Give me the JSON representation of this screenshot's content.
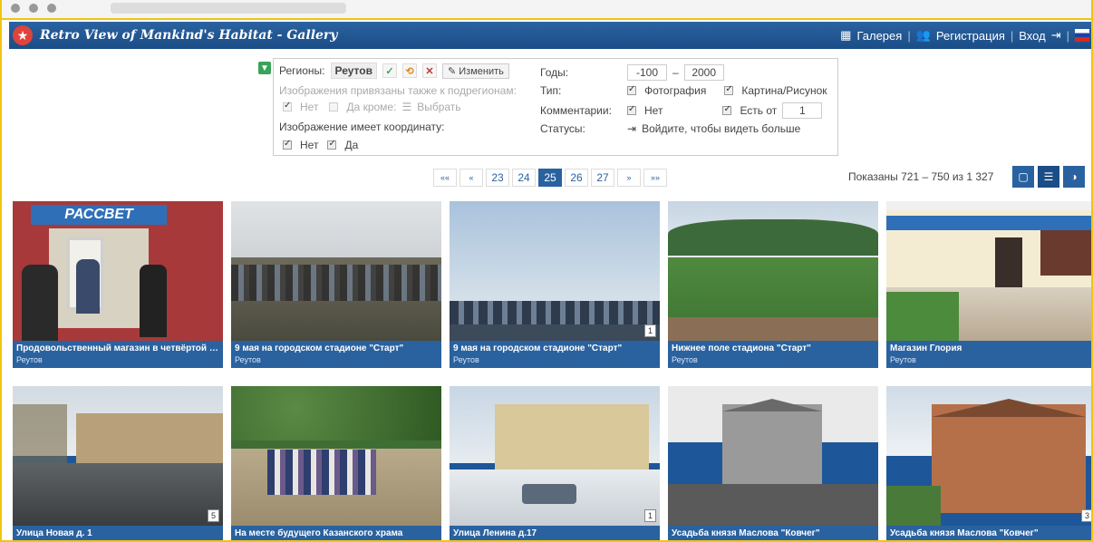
{
  "site": {
    "title": "Retro View of Mankind's Habitat  -  Gallery"
  },
  "nav": {
    "gallery": "Галерея",
    "register": "Регистрация",
    "login": "Вход"
  },
  "filter": {
    "regions_label": "Регионы:",
    "region_value": "Реутов",
    "edit_label": "Изменить",
    "subregions_label": "Изображения привязаны также к подрегионам:",
    "sub_no": "Нет",
    "sub_yes_except": "Да кроме:",
    "sub_choose": "Выбрать",
    "coords_label": "Изображение имеет координату:",
    "coords_no": "Нет",
    "coords_yes": "Да",
    "years_label": "Годы:",
    "year_from": "-100",
    "year_dash": "–",
    "year_to": "2000",
    "type_label": "Тип:",
    "type_photo": "Фотография",
    "type_painting": "Картина/Рисунок",
    "comments_label": "Комментарии:",
    "comments_no": "Нет",
    "comments_from": "Есть от",
    "comments_min": "1",
    "status_label": "Статусы:",
    "status_login": "Войдите, чтобы видеть больше"
  },
  "pager": {
    "first": "««",
    "prev": "«",
    "pages": [
      "23",
      "24",
      "25",
      "26",
      "27"
    ],
    "active": "25",
    "next": "»",
    "last": "»»"
  },
  "shown": "Показаны 721 – 750 из 1 327",
  "photos": [
    {
      "title": "Продовольственный магазин в четвёртой каза...",
      "region": "Реутов",
      "count": ""
    },
    {
      "title": "9 мая на городском стадионе \"Старт\"",
      "region": "Реутов",
      "count": ""
    },
    {
      "title": "9 мая на городском стадионе \"Старт\"",
      "region": "Реутов",
      "count": "1"
    },
    {
      "title": "Нижнее поле стадиона \"Старт\"",
      "region": "Реутов",
      "count": ""
    },
    {
      "title": "Магазин Глория",
      "region": "Реутов",
      "count": ""
    },
    {
      "title": "Улица Новая д. 1",
      "region": "",
      "count": "5"
    },
    {
      "title": "На месте будущего Казанского храма",
      "region": "",
      "count": ""
    },
    {
      "title": "Улица Ленина д.17",
      "region": "",
      "count": "1"
    },
    {
      "title": "Усадьба князя Маслова \"Ковчег\"",
      "region": "",
      "count": ""
    },
    {
      "title": "Усадьба князя Маслова \"Ковчег\"",
      "region": "",
      "count": "3"
    }
  ],
  "shop_sign": "РАССВЕТ",
  "icons": {
    "filter": "filter-icon",
    "gallery": "grid-icon",
    "register": "users-icon",
    "login": "login-icon"
  }
}
